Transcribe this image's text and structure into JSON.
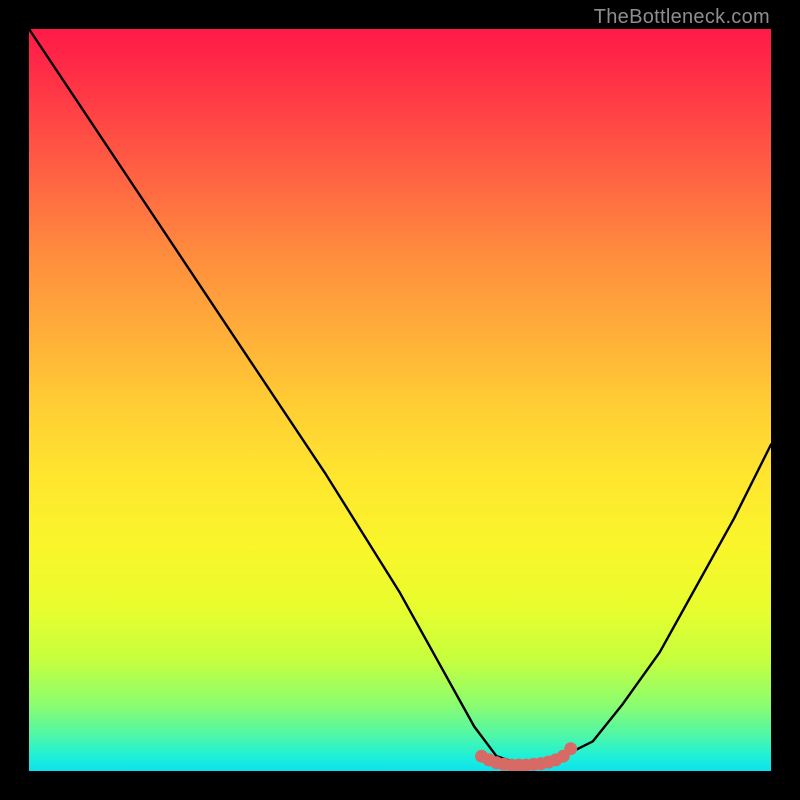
{
  "watermark": "TheBottleneck.com",
  "chart_data": {
    "type": "line",
    "title": "",
    "xlabel": "",
    "ylabel": "",
    "xlim": [
      0,
      100
    ],
    "ylim": [
      0,
      100
    ],
    "grid": false,
    "series": [
      {
        "name": "bottleneck-curve",
        "color": "#000000",
        "x": [
          0,
          10,
          20,
          30,
          40,
          50,
          55,
          60,
          63,
          66,
          69,
          72,
          76,
          80,
          85,
          90,
          95,
          100
        ],
        "values": [
          100,
          85,
          70,
          55,
          40,
          24,
          15,
          6,
          2,
          1,
          1,
          2,
          4,
          9,
          16,
          25,
          34,
          44
        ]
      },
      {
        "name": "optimal-range",
        "type": "scatter",
        "color": "#d86a66",
        "x": [
          61,
          62,
          63,
          64,
          65,
          66,
          67,
          68,
          69,
          70,
          71,
          72,
          73
        ],
        "values": [
          2,
          1.5,
          1.1,
          0.9,
          0.8,
          0.8,
          0.8,
          0.9,
          1.0,
          1.2,
          1.5,
          2,
          3
        ]
      }
    ]
  }
}
